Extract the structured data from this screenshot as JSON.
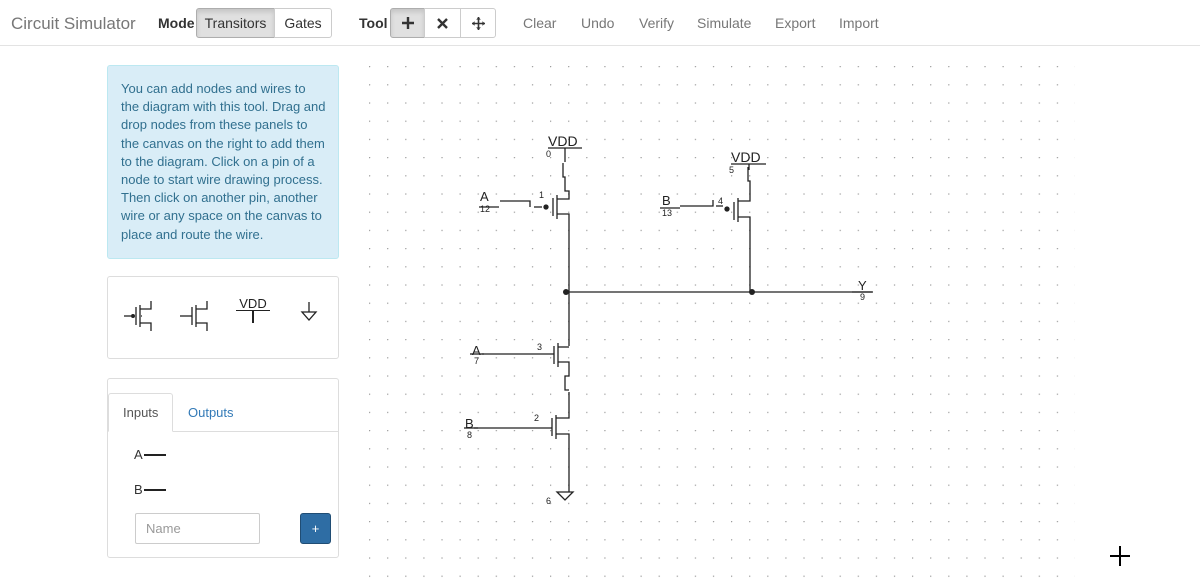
{
  "app": {
    "title": "Circuit Simulator"
  },
  "toolbar": {
    "mode_label": "Mode",
    "mode_buttons": [
      "Transitors",
      "Gates"
    ],
    "tool_label": "Tool",
    "tool_icons": [
      "plus-icon",
      "cross-icon",
      "move-icon"
    ],
    "actions": [
      "Clear",
      "Undo",
      "Verify",
      "Simulate",
      "Export",
      "Import"
    ]
  },
  "info": {
    "text": "You can add nodes and wires to the diagram with this tool. Drag and drop nodes from these panels to the canvas on the right to add them to the diagram. Click on a pin of a node to start wire drawing process. Then click on another pin, another wire or any space on the canvas to place and route the wire."
  },
  "palette": {
    "vdd_label": "VDD"
  },
  "io_panel": {
    "tabs": [
      "Inputs",
      "Outputs"
    ],
    "inputs": [
      "A",
      "B"
    ],
    "name_placeholder": "Name",
    "add_label": "+"
  },
  "circuit": {
    "vdd_labels": [
      {
        "text": "VDD",
        "id": "0"
      },
      {
        "text": "VDD",
        "id": "5"
      }
    ],
    "inputs": [
      {
        "name": "A",
        "id": "12"
      },
      {
        "name": "B",
        "id": "13"
      },
      {
        "name": "A",
        "id": "7"
      },
      {
        "name": "B",
        "id": "8"
      }
    ],
    "transistors": [
      {
        "id": "1",
        "type": "pmos"
      },
      {
        "id": "4",
        "type": "pmos"
      },
      {
        "id": "3",
        "type": "nmos"
      },
      {
        "id": "2",
        "type": "nmos"
      }
    ],
    "output": {
      "name": "Y",
      "id": "9"
    },
    "ground": {
      "id": "6"
    }
  }
}
